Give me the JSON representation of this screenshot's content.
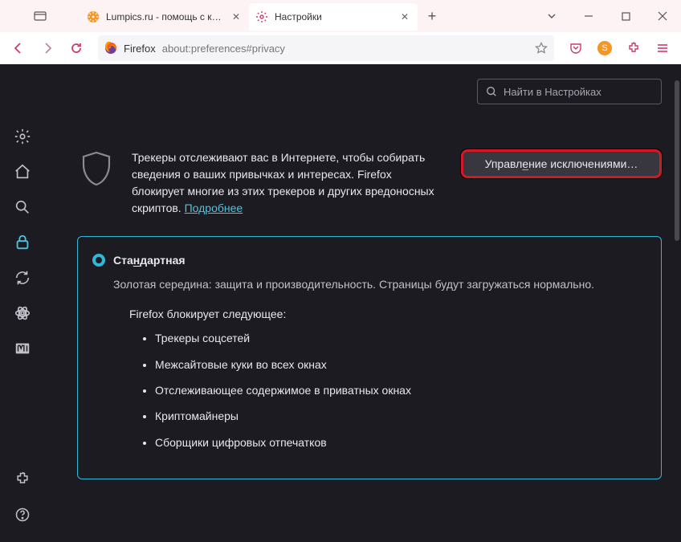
{
  "tabs": {
    "inactive": {
      "label": "Lumpics.ru - помощь с компь"
    },
    "active": {
      "label": "Настройки"
    }
  },
  "toolbar": {
    "ff_label": "Firefox",
    "url": "about:preferences#privacy"
  },
  "search": {
    "placeholder": "Найти в Настройках"
  },
  "intro": {
    "text": "Трекеры отслеживают вас в Интернете, чтобы собирать сведения о ваших привычках и интересах. Firefox блокирует многие из этих трекеров и других вредоносных скриптов.",
    "link": "Подробнее"
  },
  "exceptions_button": {
    "pre": "Управл",
    "u": "е",
    "post": "ние исключениями…"
  },
  "card": {
    "title_pre": "Ста",
    "title_u": "н",
    "title_post": "дартная",
    "desc": "Золотая середина: защита и производительность. Страницы будут загружаться нормально.",
    "blocks_label": "Firefox блокирует следующее:",
    "items": [
      "Трекеры соцсетей",
      "Межсайтовые куки во всех окнах",
      "Отслеживающее содержимое в приватных окнах",
      "Криптомайнеры",
      "Сборщики цифровых отпечатков"
    ]
  }
}
